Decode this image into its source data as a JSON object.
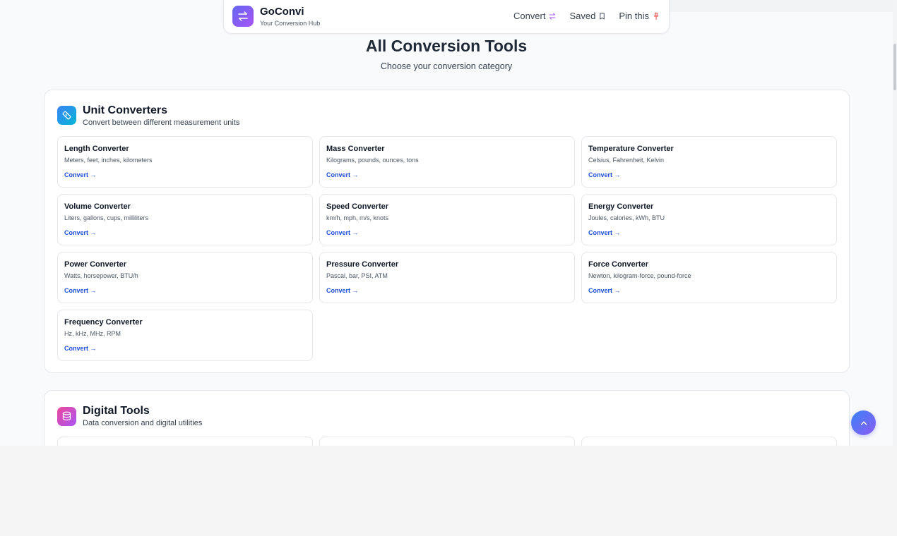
{
  "brand": {
    "name": "GoConvi",
    "tagline": "Your Conversion Hub"
  },
  "nav": {
    "convert": "Convert",
    "saved": "Saved",
    "pin": "Pin this"
  },
  "page": {
    "title": "All Conversion Tools",
    "subtitle": "Choose your conversion category"
  },
  "sections": {
    "unit": {
      "title": "Unit Converters",
      "description": "Convert between different measurement units",
      "cards": [
        {
          "title": "Length Converter",
          "desc": "Meters, feet, inches, kilometers",
          "link": "Convert →"
        },
        {
          "title": "Mass Converter",
          "desc": "Kilograms, pounds, ounces, tons",
          "link": "Convert →"
        },
        {
          "title": "Temperature Converter",
          "desc": "Celsius, Fahrenheit, Kelvin",
          "link": "Convert →"
        },
        {
          "title": "Volume Converter",
          "desc": "Liters, gallons, cups, milliliters",
          "link": "Convert →"
        },
        {
          "title": "Speed Converter",
          "desc": "km/h, mph, m/s, knots",
          "link": "Convert →"
        },
        {
          "title": "Energy Converter",
          "desc": "Joules, calories, kWh, BTU",
          "link": "Convert →"
        },
        {
          "title": "Power Converter",
          "desc": "Watts, horsepower, BTU/h",
          "link": "Convert →"
        },
        {
          "title": "Pressure Converter",
          "desc": "Pascal, bar, PSI, ATM",
          "link": "Convert →"
        },
        {
          "title": "Force Converter",
          "desc": "Newton, kilogram-force, pound-force",
          "link": "Convert →"
        },
        {
          "title": "Frequency Converter",
          "desc": "Hz, kHz, MHz, RPM",
          "link": "Convert →"
        }
      ]
    },
    "digital": {
      "title": "Digital Tools",
      "description": "Data conversion and digital utilities"
    }
  },
  "icons": {
    "logo": "swap-arrows-icon",
    "convert": "swap-icon",
    "saved": "bookmark-icon",
    "pin": "pin-icon",
    "unit_section": "ruler-icon",
    "digital_section": "database-icon",
    "fab": "chevron-up-icon"
  },
  "colors": {
    "accent_purple": "#a855f7",
    "link_blue": "#1d4ed8",
    "pin_red": "#ef4444"
  }
}
